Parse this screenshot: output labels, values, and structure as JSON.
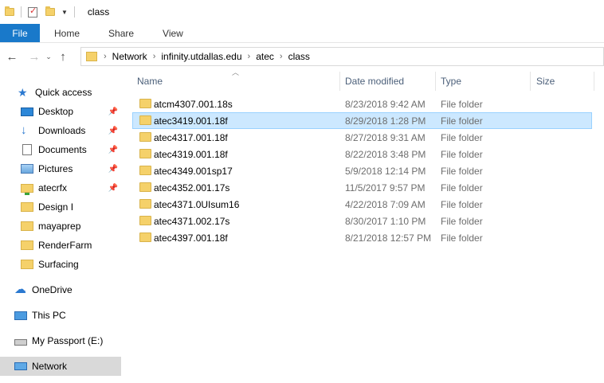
{
  "window": {
    "title": "class"
  },
  "ribbon": {
    "tabs": [
      "File",
      "Home",
      "Share",
      "View"
    ]
  },
  "address": {
    "crumbs": [
      "Network",
      "infinity.utdallas.edu",
      "atec",
      "class"
    ]
  },
  "columns": {
    "name": "Name",
    "date": "Date modified",
    "type": "Type",
    "size": "Size"
  },
  "sidebar": {
    "items": [
      {
        "label": "Quick access",
        "icon": "star-icon"
      },
      {
        "label": "Desktop",
        "icon": "desktop-icon",
        "pinned": true
      },
      {
        "label": "Downloads",
        "icon": "download-arrow-icon",
        "pinned": true
      },
      {
        "label": "Documents",
        "icon": "document-icon",
        "pinned": true
      },
      {
        "label": "Pictures",
        "icon": "pictures-icon",
        "pinned": true
      },
      {
        "label": "atecrfx",
        "icon": "network-folder-icon",
        "pinned": true
      },
      {
        "label": "Design I",
        "icon": "folder-icon"
      },
      {
        "label": "mayaprep",
        "icon": "folder-icon"
      },
      {
        "label": "RenderFarm",
        "icon": "folder-icon"
      },
      {
        "label": "Surfacing",
        "icon": "folder-icon"
      },
      {
        "label": "OneDrive",
        "icon": "cloud-icon"
      },
      {
        "label": "This PC",
        "icon": "computer-icon"
      },
      {
        "label": "My Passport (E:)",
        "icon": "drive-icon"
      },
      {
        "label": "Network",
        "icon": "network-icon",
        "selected": true
      }
    ]
  },
  "files": [
    {
      "name": "atcm4307.001.18s",
      "date": "8/23/2018 9:42 AM",
      "type": "File folder"
    },
    {
      "name": "atec3419.001.18f",
      "date": "8/29/2018 1:28 PM",
      "type": "File folder",
      "selected": true
    },
    {
      "name": "atec4317.001.18f",
      "date": "8/27/2018 9:31 AM",
      "type": "File folder"
    },
    {
      "name": "atec4319.001.18f",
      "date": "8/22/2018 3:48 PM",
      "type": "File folder"
    },
    {
      "name": "atec4349.001sp17",
      "date": "5/9/2018 12:14 PM",
      "type": "File folder"
    },
    {
      "name": "atec4352.001.17s",
      "date": "11/5/2017 9:57 PM",
      "type": "File folder"
    },
    {
      "name": "atec4371.0UIsum16",
      "date": "4/22/2018 7:09 AM",
      "type": "File folder"
    },
    {
      "name": "atec4371.002.17s",
      "date": "8/30/2017 1:10 PM",
      "type": "File folder"
    },
    {
      "name": "atec4397.001.18f",
      "date": "8/21/2018 12:57 PM",
      "type": "File folder"
    }
  ]
}
